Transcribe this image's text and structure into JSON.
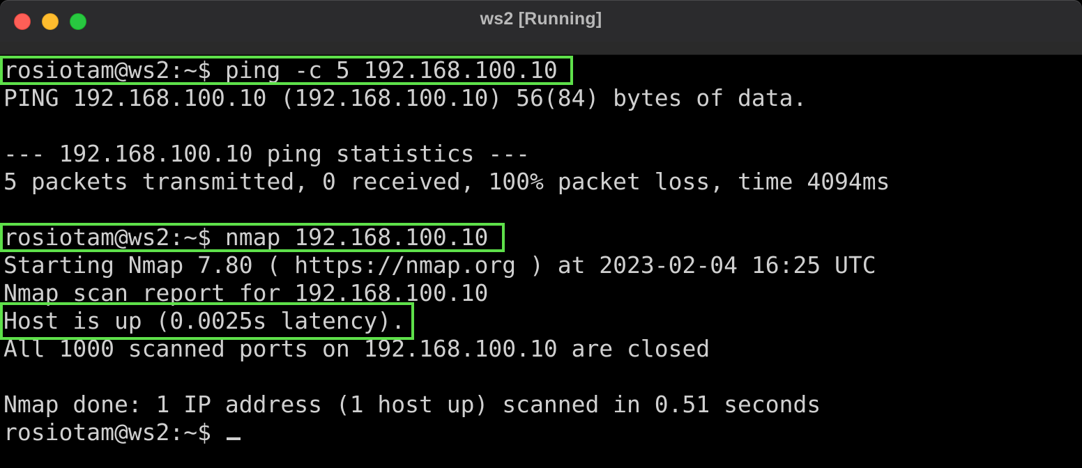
{
  "window": {
    "title": "ws2 [Running]"
  },
  "terminal": {
    "lines": [
      "rosiotam@ws2:~$ ping -c 5 192.168.100.10",
      "PING 192.168.100.10 (192.168.100.10) 56(84) bytes of data.",
      "",
      "--- 192.168.100.10 ping statistics ---",
      "5 packets transmitted, 0 received, 100% packet loss, time 4094ms",
      "",
      "rosiotam@ws2:~$ nmap 192.168.100.10",
      "Starting Nmap 7.80 ( https://nmap.org ) at 2023-02-04 16:25 UTC",
      "Nmap scan report for 192.168.100.10",
      "Host is up (0.0025s latency).",
      "All 1000 scanned ports on 192.168.100.10 are closed",
      "",
      "Nmap done: 1 IP address (1 host up) scanned in 0.51 seconds",
      "rosiotam@ws2:~$ "
    ]
  },
  "colors": {
    "highlight": "#5ee04a",
    "terminal_text": "#d0d0d0",
    "terminal_bg": "#000000"
  }
}
